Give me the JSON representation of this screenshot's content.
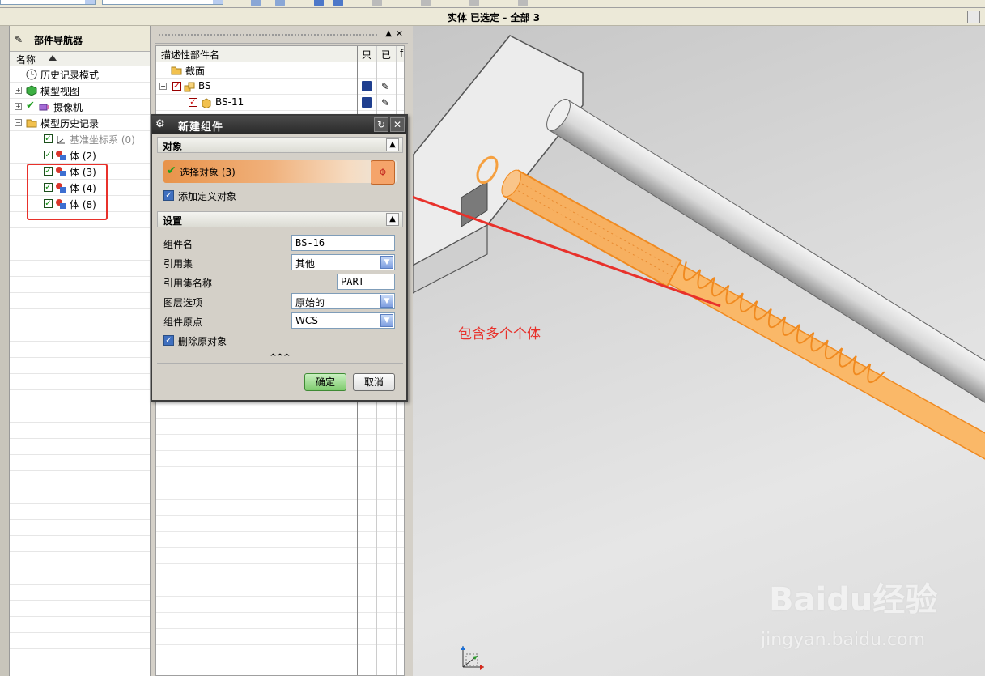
{
  "status_bar": {
    "text": "实体 已选定 - 全部 3"
  },
  "part_navigator": {
    "title": "部件导航器",
    "column_header": "名称",
    "items": [
      {
        "label": "历史记录模式",
        "icon": "clock-icon"
      },
      {
        "label": "模型视图",
        "icon": "model-view-icon"
      },
      {
        "label": "摄像机",
        "icon": "camera-icon"
      },
      {
        "label": "模型历史记录",
        "icon": "folder-icon"
      },
      {
        "label": "基准坐标系 (0)",
        "icon": "datum-csys-icon"
      },
      {
        "label": "体 (2)",
        "icon": "body-icon"
      },
      {
        "label": "体 (3)",
        "icon": "body-icon"
      },
      {
        "label": "体 (4)",
        "icon": "body-icon"
      },
      {
        "label": "体 (8)",
        "icon": "body-icon"
      }
    ]
  },
  "assembly_navigator": {
    "columns": [
      "描述性部件名",
      "只",
      "已",
      "f"
    ],
    "rows": [
      {
        "label": "截面",
        "icon": "folder-icon"
      },
      {
        "label": "BS",
        "icon": "assembly-icon"
      },
      {
        "label": "BS-11",
        "icon": "part-icon"
      }
    ]
  },
  "dialog": {
    "title": "新建组件",
    "section_object": "对象",
    "select_object": "选择对象 (3)",
    "add_defined_objects": "添加定义对象",
    "section_settings": "设置",
    "fields": {
      "component_name_label": "组件名",
      "component_name_value": "BS-16",
      "reference_set_label": "引用集",
      "reference_set_value": "其他",
      "reference_set_name_label": "引用集名称",
      "reference_set_name_value": "PART",
      "layer_option_label": "图层选项",
      "layer_option_value": "原始的",
      "component_origin_label": "组件原点",
      "component_origin_value": "WCS",
      "delete_original_label": "删除原对象"
    },
    "more_glyph": "^^^",
    "ok": "确定",
    "cancel": "取消"
  },
  "viewport": {
    "annotation": "包含多个个体",
    "watermark_logo": "Baidu经验",
    "watermark_url": "jingyan.baidu.com"
  },
  "colors": {
    "highlight": "#f5a040",
    "annotation_red": "#e8312b",
    "dialog_title": "#2a2a2a"
  }
}
